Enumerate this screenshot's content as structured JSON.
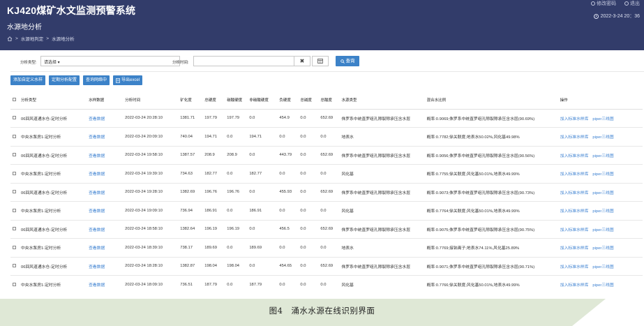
{
  "header": {
    "title": "KJ420煤矿水文监测预警系统",
    "links": [
      "修改密码",
      "退出"
    ],
    "datetime": "2022-3-24 20：36",
    "page_title": "水源地分析",
    "breadcrumb": [
      "水源地判定",
      "水源地分析"
    ]
  },
  "filter": {
    "type_label": "分析类型:",
    "type_value": "请选择 ▾",
    "time_label": "分析时间:",
    "clear_symbol": "✖",
    "search_label": "查询"
  },
  "actions": {
    "add_custom": "添加自定义水样",
    "timed_config": "定期分析配置",
    "view_network": "查询网络中",
    "export": "导出excel"
  },
  "table": {
    "headers": [
      "分析类型",
      "水样数据",
      "分析时间",
      "矿化度",
      "总硬度",
      "碳酸硬度",
      "非碳酸硬度",
      "负硬度",
      "总碱度",
      "总酸度",
      "水源类型",
      "混合水比例",
      "操作"
    ],
    "rows": [
      [
        "06回风道通水仓-定时分析",
        "查看数据",
        "2022-03-24 20:28:10",
        "1381.71",
        "197.79",
        "197.79",
        "0.0",
        "454.9",
        "0.0",
        "652.69",
        "侏罗系中统直罗组孔隙裂隙承压含水层",
        "概率:0.9069;侏罗系中统直罗组孔隙裂隙承压含水层(90.69%)"
      ],
      [
        "中央水泵房1-定时分析",
        "查看数据",
        "2022-03-24 20:09:10",
        "740.04",
        "194.71",
        "0.0",
        "194.71",
        "0.0",
        "0.0",
        "0.0",
        "地表水",
        "概率:0.7782;徐关联度;地表水50.02%,风化基49.98%"
      ],
      [
        "06回风道通水仓-定时分析",
        "查看数据",
        "2022-03-24 19:58:10",
        "1387.57",
        "208.9",
        "208.9",
        "0.0",
        "443.79",
        "0.0",
        "652.69",
        "侏罗系中统直罗组孔隙裂隙承压含水层",
        "概率:0.9056;侏罗系中统直罗组孔隙裂隙承压含水层(90.56%)"
      ],
      [
        "中央水泵房1-定时分析",
        "查看数据",
        "2022-03-24 19:39:10",
        "734.63",
        "182.77",
        "0.0",
        "182.77",
        "0.0",
        "0.0",
        "0.0",
        "风化基",
        "概率:0.7755;徐关联度;风化基50.01%,地表水49.99%"
      ],
      [
        "06回风道通水仓-定时分析",
        "查看数据",
        "2022-03-24 19:28:10",
        "1382.69",
        "196.76",
        "196.76",
        "0.0",
        "455.93",
        "0.0",
        "652.69",
        "侏罗系中统直罗组孔隙裂隙承压含水层",
        "概率:0.9073;侏罗系中统直罗组孔隙裂隙承压含水层(90.73%)"
      ],
      [
        "中央水泵房1-定时分析",
        "查看数据",
        "2022-03-24 19:09:10",
        "736.94",
        "186.91",
        "0.0",
        "186.91",
        "0.0",
        "0.0",
        "0.0",
        "风化基",
        "概率:0.7764;徐关联度;风化基50.01%,地表水49.99%"
      ],
      [
        "06回风道通水仓-定时分析",
        "查看数据",
        "2022-03-24 18:58:10",
        "1382.64",
        "196.19",
        "196.19",
        "0.0",
        "456.5",
        "0.0",
        "652.69",
        "侏罗系中统直罗组孔隙裂隙承压含水层",
        "概率:0.9075;侏罗系中统直罗组孔隙裂隙承压含水层(90.75%)"
      ],
      [
        "中央水泵房1-定时分析",
        "查看数据",
        "2022-03-24 18:39:10",
        "738.17",
        "189.69",
        "0.0",
        "189.69",
        "0.0",
        "0.0",
        "0.0",
        "地表水",
        "概率:0.7769;接钠离子;地表水74.11%,风化基25.89%"
      ],
      [
        "06回风道通水仓-定时分析",
        "查看数据",
        "2022-03-24 18:28:10",
        "1382.87",
        "198.04",
        "198.04",
        "0.0",
        "454.65",
        "0.0",
        "652.69",
        "侏罗系中统直罗组孔隙裂隙承压含水层",
        "概率:0.9071;侏罗系中统直罗组孔隙裂隙承压含水层(90.71%)"
      ],
      [
        "中央水泵房1-定时分析",
        "查看数据",
        "2022-03-24 18:09:10",
        "736.51",
        "187.79",
        "0.0",
        "187.79",
        "0.0",
        "0.0",
        "0.0",
        "风化基",
        "概率:0.7766;徐关联度;风化基50.01%,地表水49.99%"
      ]
    ],
    "op_add": "加入标准水样库",
    "op_piper": "piper三线图"
  },
  "caption": "图4　涌水水源在线识别界面",
  "colors": {
    "header_bg": "#323c6a",
    "primary_button": "#3c82c8",
    "link": "#3a7fd0",
    "caption_band": "#dfe8d6"
  }
}
